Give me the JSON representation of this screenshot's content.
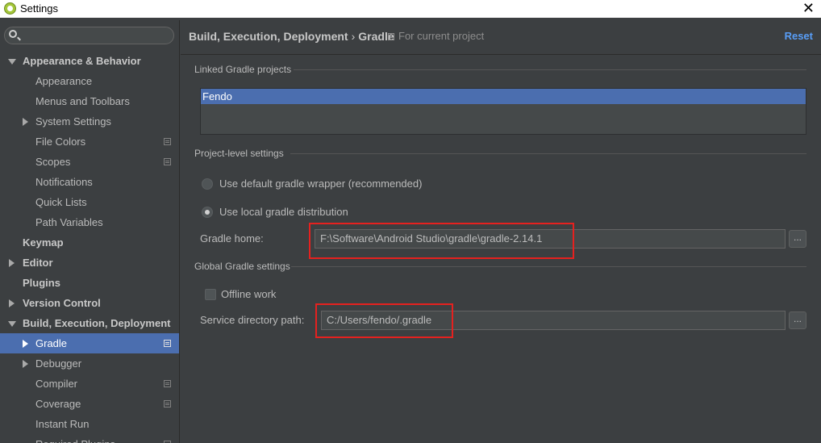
{
  "window": {
    "title": "Settings"
  },
  "search": {
    "placeholder": "",
    "value": ""
  },
  "sidebar": {
    "items": [
      {
        "label": "Appearance & Behavior",
        "level": "top",
        "arrow": "down"
      },
      {
        "label": "Appearance",
        "level": "child"
      },
      {
        "label": "Menus and Toolbars",
        "level": "child"
      },
      {
        "label": "System Settings",
        "level": "child",
        "arrow": "right"
      },
      {
        "label": "File Colors",
        "level": "child",
        "project": true
      },
      {
        "label": "Scopes",
        "level": "child",
        "project": true
      },
      {
        "label": "Notifications",
        "level": "child"
      },
      {
        "label": "Quick Lists",
        "level": "child"
      },
      {
        "label": "Path Variables",
        "level": "child"
      },
      {
        "label": "Keymap",
        "level": "top"
      },
      {
        "label": "Editor",
        "level": "top",
        "arrow": "right"
      },
      {
        "label": "Plugins",
        "level": "top"
      },
      {
        "label": "Version Control",
        "level": "top",
        "arrow": "right"
      },
      {
        "label": "Build, Execution, Deployment",
        "level": "top",
        "arrow": "down"
      },
      {
        "label": "Gradle",
        "level": "child",
        "arrow": "right",
        "project": true,
        "selected": true
      },
      {
        "label": "Debugger",
        "level": "child",
        "arrow": "right"
      },
      {
        "label": "Compiler",
        "level": "child",
        "project": true
      },
      {
        "label": "Coverage",
        "level": "child",
        "project": true
      },
      {
        "label": "Instant Run",
        "level": "child"
      },
      {
        "label": "Required Plugins",
        "level": "child",
        "project": true
      }
    ]
  },
  "header": {
    "breadcrumb_parent": "Build, Execution, Deployment",
    "breadcrumb_sep": "›",
    "breadcrumb_current": "Gradle",
    "scope": "For current project",
    "reset": "Reset"
  },
  "linked": {
    "title": "Linked Gradle projects",
    "projects": [
      "Fendo"
    ]
  },
  "project_level": {
    "title": "Project-level settings",
    "option_default": "Use default gradle wrapper (recommended)",
    "option_local": "Use local gradle distribution",
    "selected_option": "local",
    "gradle_home_label": "Gradle home:",
    "gradle_home_value": "F:\\Software\\Android Studio\\gradle\\gradle-2.14.1",
    "browse_label": "..."
  },
  "global": {
    "title": "Global Gradle settings",
    "offline_label": "Offline work",
    "offline_checked": false,
    "service_dir_label": "Service directory path:",
    "service_dir_value": "C:/Users/fendo/.gradle",
    "browse_label": "..."
  },
  "colors": {
    "accent": "#4b6eaf",
    "link": "#589df6",
    "annotation": "#e5211f"
  }
}
